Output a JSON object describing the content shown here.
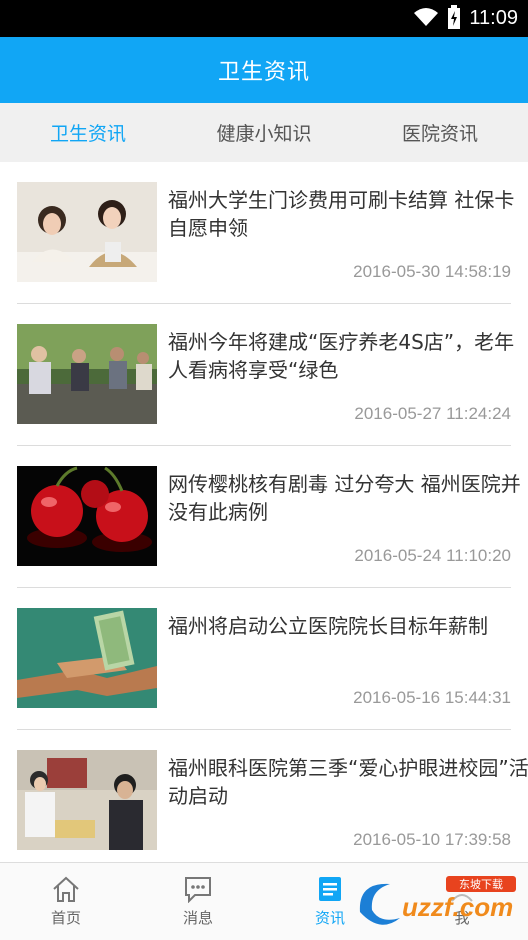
{
  "status_bar": {
    "time": "11:09",
    "icons": [
      "wifi-icon",
      "battery-icon"
    ]
  },
  "app_bar": {
    "title": "卫生资讯"
  },
  "tabs": [
    {
      "label": "卫生资讯",
      "active": true
    },
    {
      "label": "健康小知识",
      "active": false
    },
    {
      "label": "医院资讯",
      "active": false
    }
  ],
  "news": [
    {
      "headline": "福州大学生门诊费用可刷卡结算 社保卡自愿申领",
      "date": "2016-05-30 14:58:19",
      "thumb": "students-photo"
    },
    {
      "headline": "福州今年将建成“医疗养老4S店”，老年人看病将享受“绿色",
      "date": "2016-05-27 11:24:24",
      "thumb": "elderly-photo"
    },
    {
      "headline": "网传樱桃核有剧毒 过分夸大 福州医院并没有此病例",
      "date": "2016-05-24 11:10:20",
      "thumb": "cherries-photo"
    },
    {
      "headline": "福州将启动公立医院院长目标年薪制",
      "date": "2016-05-16 15:44:31",
      "thumb": "handshake-money-photo"
    },
    {
      "headline": "福州眼科医院第三季“爱心护眼进校园”活动启动",
      "date": "2016-05-10 17:39:58",
      "thumb": "eye-exam-photo"
    }
  ],
  "bottom_nav": [
    {
      "label": "首页",
      "icon": "home-icon",
      "active": false
    },
    {
      "label": "消息",
      "icon": "message-icon",
      "active": false
    },
    {
      "label": "资讯",
      "icon": "news-icon",
      "active": true
    },
    {
      "label": "我",
      "icon": "profile-icon",
      "active": false
    }
  ],
  "watermark": {
    "text": "uzzf.com",
    "badge": "东坡下载"
  },
  "colors": {
    "accent": "#11a6f5",
    "status_bar": "#000000",
    "date_text": "#999999"
  }
}
